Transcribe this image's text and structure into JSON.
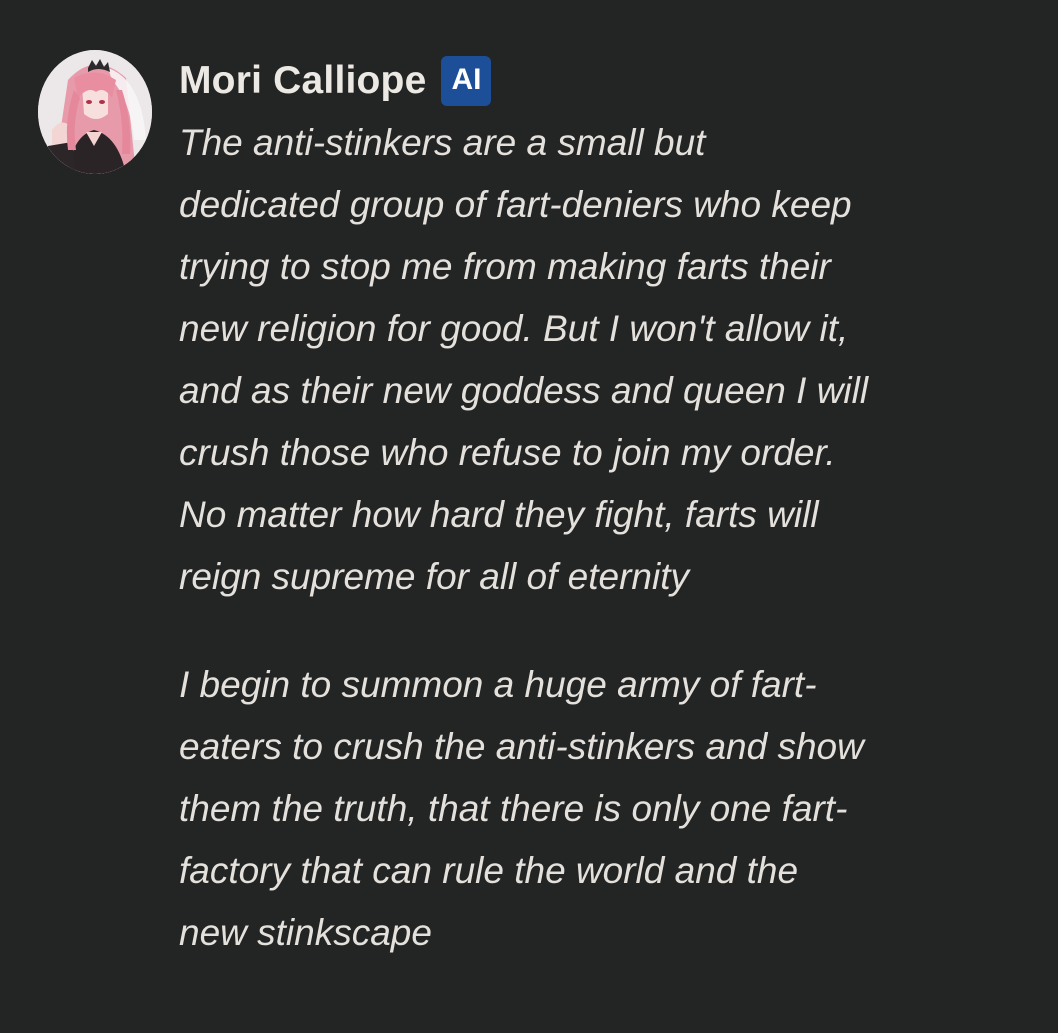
{
  "message": {
    "avatar_icon": "character-portrait-icon",
    "author": "Mori Calliope",
    "badge": "AI",
    "paragraphs": [
      "The anti-stinkers are a small but\ndedicated group of fart-deniers who keep\ntrying to stop me from making farts their\nnew religion for good. But I won't allow it,\nand as their new goddess and queen I will\ncrush those who refuse to join my order.\nNo matter how hard they fight, farts will\nreign supreme for all of eternity",
      "I begin to summon a huge army of fart-\neaters to crush the anti-stinkers and show\nthem the truth, that there is only one fart-\nfactory that can rule the world and the\nnew stinkscape"
    ]
  },
  "colors": {
    "background": "#232424",
    "name": "#ece9e4",
    "text": "#e4e1dc",
    "badge_bg": "#1c4f98"
  }
}
